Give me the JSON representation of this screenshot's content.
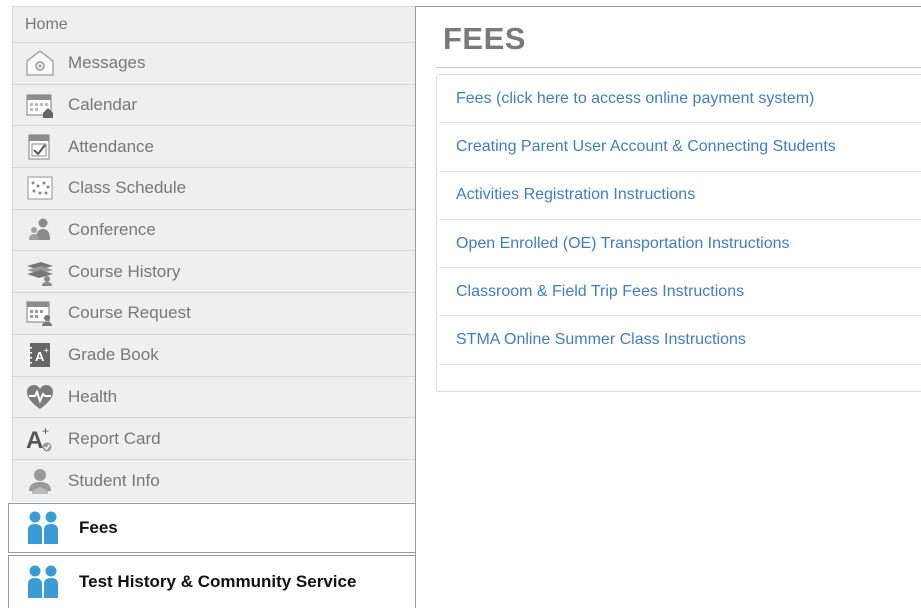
{
  "sidebar": {
    "home": "Home",
    "items": [
      {
        "label": "Messages",
        "icon": "envelope-icon"
      },
      {
        "label": "Calendar",
        "icon": "calendar-icon"
      },
      {
        "label": "Attendance",
        "icon": "attendance-icon"
      },
      {
        "label": "Class Schedule",
        "icon": "schedule-icon"
      },
      {
        "label": "Conference",
        "icon": "conference-icon"
      },
      {
        "label": "Course History",
        "icon": "books-icon"
      },
      {
        "label": "Course Request",
        "icon": "course-request-icon"
      },
      {
        "label": "Grade Book",
        "icon": "gradebook-icon"
      },
      {
        "label": "Health",
        "icon": "heart-icon"
      },
      {
        "label": "Report Card",
        "icon": "report-card-icon"
      },
      {
        "label": "Student Info",
        "icon": "student-icon"
      }
    ],
    "active_tabs": [
      {
        "label": "Fees",
        "icon": "people-icon"
      },
      {
        "label": "Test History & Community Service",
        "icon": "people-icon"
      }
    ]
  },
  "main": {
    "title": "FEES",
    "links": [
      "Fees (click here to access online payment system)",
      "Creating Parent User Account & Connecting Students",
      "Activities Registration Instructions",
      "Open Enrolled (OE) Transportation Instructions",
      "Classroom & Field Trip Fees Instructions",
      "STMA Online Summer Class Instructions"
    ]
  },
  "colors": {
    "link": "#3f7fbf",
    "sidebar_bg": "#efefef",
    "people_icon": "#3a9bd5"
  }
}
